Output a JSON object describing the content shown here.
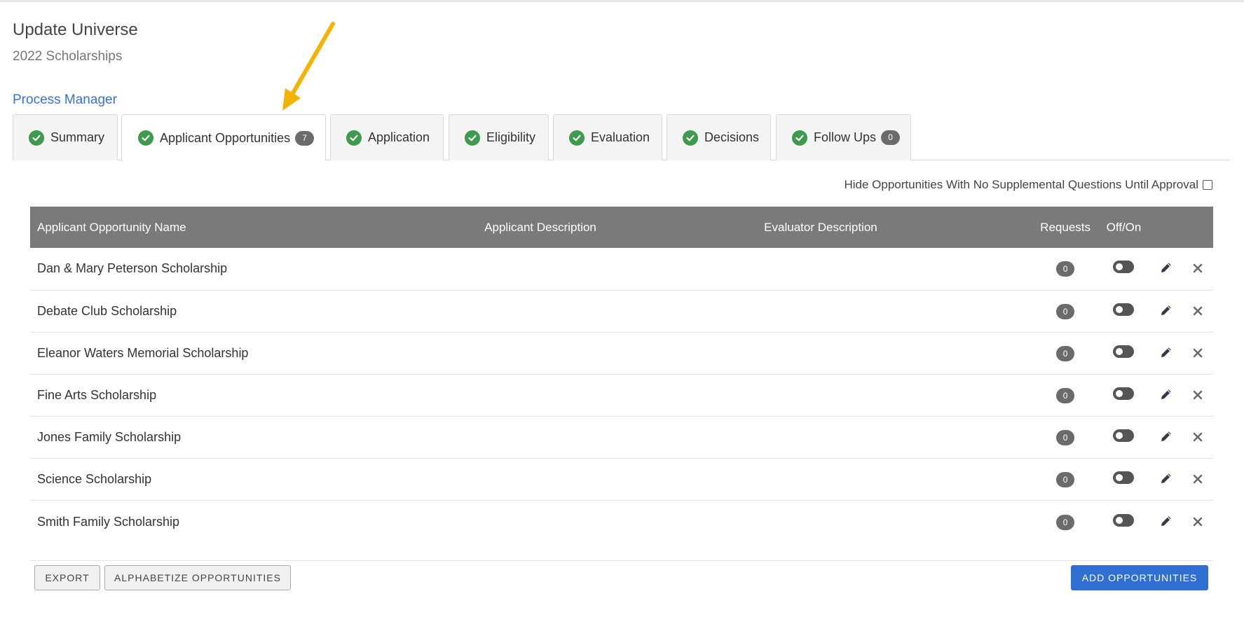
{
  "header": {
    "title": "Update Universe",
    "subtitle": "2022 Scholarships",
    "process_manager_link": "Process Manager"
  },
  "tabs": [
    {
      "label": "Summary",
      "status": "complete"
    },
    {
      "label": "Applicant Opportunities",
      "status": "complete",
      "badge": "7",
      "active": true
    },
    {
      "label": "Application",
      "status": "complete"
    },
    {
      "label": "Eligibility",
      "status": "complete"
    },
    {
      "label": "Evaluation",
      "status": "complete"
    },
    {
      "label": "Decisions",
      "status": "complete"
    },
    {
      "label": "Follow Ups",
      "status": "complete",
      "badge": "0"
    }
  ],
  "options": {
    "hide_no_supplemental_label": "Hide Opportunities With No Supplemental Questions Until Approval",
    "hide_no_supplemental_checked": false
  },
  "table": {
    "columns": [
      "Applicant Opportunity Name",
      "Applicant Description",
      "Evaluator Description",
      "Requests",
      "Off/On"
    ],
    "rows": [
      {
        "name": "Dan & Mary Peterson Scholarship",
        "applicant_description": "",
        "evaluator_description": "",
        "requests": "0",
        "on": false
      },
      {
        "name": "Debate Club Scholarship",
        "applicant_description": "",
        "evaluator_description": "",
        "requests": "0",
        "on": false
      },
      {
        "name": "Eleanor Waters Memorial Scholarship",
        "applicant_description": "",
        "evaluator_description": "",
        "requests": "0",
        "on": false
      },
      {
        "name": "Fine Arts Scholarship",
        "applicant_description": "",
        "evaluator_description": "",
        "requests": "0",
        "on": false
      },
      {
        "name": "Jones Family Scholarship",
        "applicant_description": "",
        "evaluator_description": "",
        "requests": "0",
        "on": false
      },
      {
        "name": "Science Scholarship",
        "applicant_description": "",
        "evaluator_description": "",
        "requests": "0",
        "on": false
      },
      {
        "name": "Smith Family Scholarship",
        "applicant_description": "",
        "evaluator_description": "",
        "requests": "0",
        "on": false
      }
    ]
  },
  "buttons": {
    "export": "EXPORT",
    "alphabetize": "ALPHABETIZE OPPORTUNITIES",
    "add": "ADD OPPORTUNITIES"
  },
  "colors": {
    "accent": "#2f6fd1",
    "check": "#3e9a4c",
    "header_bg": "#7a7a7a",
    "arrow": "#f2b301"
  },
  "icons": {
    "tab_status": "check-circle-icon",
    "edit": "pencil-icon",
    "delete": "close-icon",
    "annotation": "arrow-annotation"
  }
}
